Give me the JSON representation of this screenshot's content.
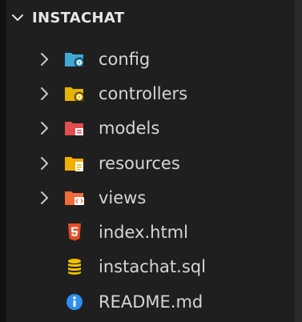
{
  "explorer": {
    "title": "INSTACHAT",
    "items": [
      {
        "label": "config",
        "kind": "folder",
        "icon": "config-folder-icon",
        "color": "#3fa9d6",
        "badge": "gear"
      },
      {
        "label": "controllers",
        "kind": "folder",
        "icon": "controllers-folder-icon",
        "color": "#e6b400",
        "badge": "gear"
      },
      {
        "label": "models",
        "kind": "folder",
        "icon": "models-folder-icon",
        "color": "#e04e4e",
        "badge": "box"
      },
      {
        "label": "resources",
        "kind": "folder",
        "icon": "resources-folder-icon",
        "color": "#f0b000",
        "badge": "doc"
      },
      {
        "label": "views",
        "kind": "folder",
        "icon": "views-folder-icon",
        "color": "#ef6b3a",
        "badge": "code"
      },
      {
        "label": "index.html",
        "kind": "file",
        "icon": "html5-icon",
        "color": "#e44d26"
      },
      {
        "label": "instachat.sql",
        "kind": "file",
        "icon": "database-icon",
        "color": "#f2c200"
      },
      {
        "label": "README.md",
        "kind": "file",
        "icon": "info-icon",
        "color": "#2f8ef0"
      }
    ]
  },
  "colors": {
    "background": "#1f1f1f",
    "text": "#d6d6d6",
    "chevron": "#c8c8c8"
  }
}
